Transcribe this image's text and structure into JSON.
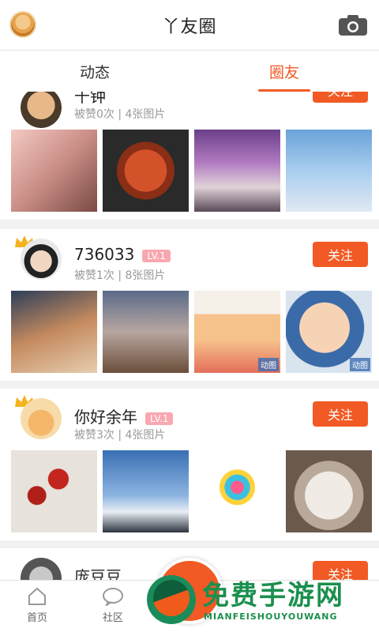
{
  "header": {
    "title": "丫友圈",
    "camera_icon": "camera-icon"
  },
  "tabs": [
    {
      "label": "动态"
    },
    {
      "label": "圈友",
      "active": true
    }
  ],
  "cards": [
    {
      "name": "千钟",
      "meta": "被赞0次 | 4张图片",
      "follow": "关注",
      "gif_labels": []
    },
    {
      "name": "736033",
      "level": "LV.1",
      "meta": "被赞1次 | 8张图片",
      "follow": "关注",
      "gif_labels": [
        "动图",
        "动图"
      ]
    },
    {
      "name": "你好余年",
      "level": "LV.1",
      "meta": "被赞3次 | 4张图片",
      "follow": "关注",
      "gif_labels": []
    },
    {
      "name": "庞豆豆",
      "follow": "关注"
    }
  ],
  "bottom_nav": [
    {
      "label": "首页",
      "icon": "home-icon"
    },
    {
      "label": "社区",
      "icon": "chat-bubble-icon"
    }
  ],
  "watermark": {
    "title": "免费手游网",
    "subtitle": "MIANFEISHOUYOUWANG"
  },
  "colors": {
    "accent": "#f15a24",
    "level_badge": "#f9a7b0",
    "watermark_green": "#1b8f4e"
  }
}
